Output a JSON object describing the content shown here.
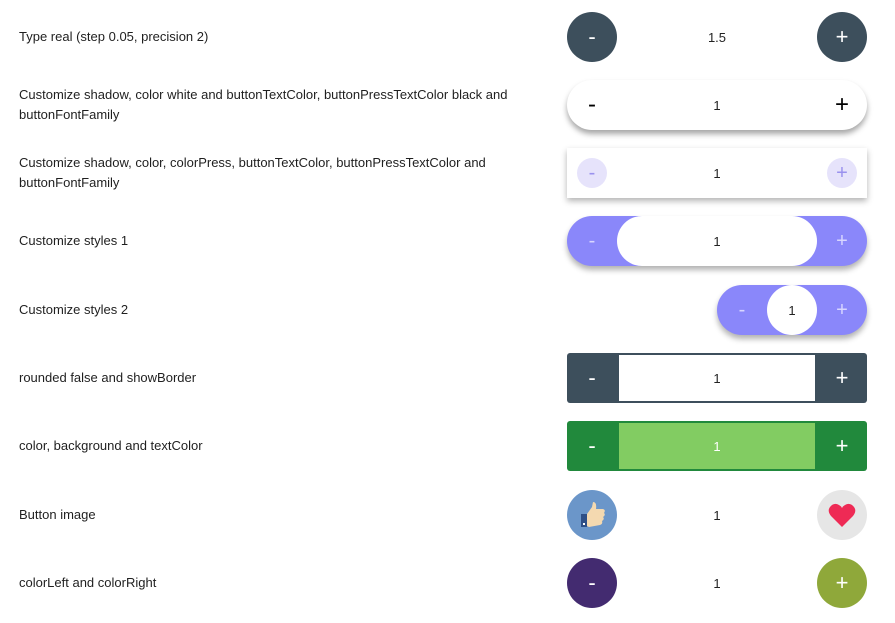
{
  "rows": [
    {
      "label": "Type real (step 0.05, precision 2)",
      "minus": "-",
      "value": "1.5",
      "plus": "+"
    },
    {
      "label": "Customize shadow, color white and buttonTextColor, buttonPressTextColor black and buttonFontFamily",
      "minus": "-",
      "value": "1",
      "plus": "+"
    },
    {
      "label": "Customize shadow, color, colorPress, buttonTextColor, buttonPressTextColor and buttonFontFamily",
      "minus": "-",
      "value": "1",
      "plus": "+"
    },
    {
      "label": "Customize styles 1",
      "minus": "-",
      "value": "1",
      "plus": "+"
    },
    {
      "label": "Customize styles 2",
      "minus": "-",
      "value": "1",
      "plus": "+"
    },
    {
      "label": "rounded false and showBorder",
      "minus": "-",
      "value": "1",
      "plus": "+"
    },
    {
      "label": "color, background and textColor",
      "minus": "-",
      "value": "1",
      "plus": "+"
    },
    {
      "label": "Button image",
      "minus_icon": "thumbs-up-icon",
      "value": "1",
      "plus_icon": "heart-icon"
    },
    {
      "label": "colorLeft and colorRight",
      "minus": "-",
      "value": "1",
      "plus": "+"
    }
  ],
  "colors": {
    "slate": "#3d4f5c",
    "periwinkle": "#8a87fa",
    "green_dark": "#21893c",
    "green_light": "#82cc62",
    "purple": "#432b70",
    "olive": "#8fa83a"
  }
}
